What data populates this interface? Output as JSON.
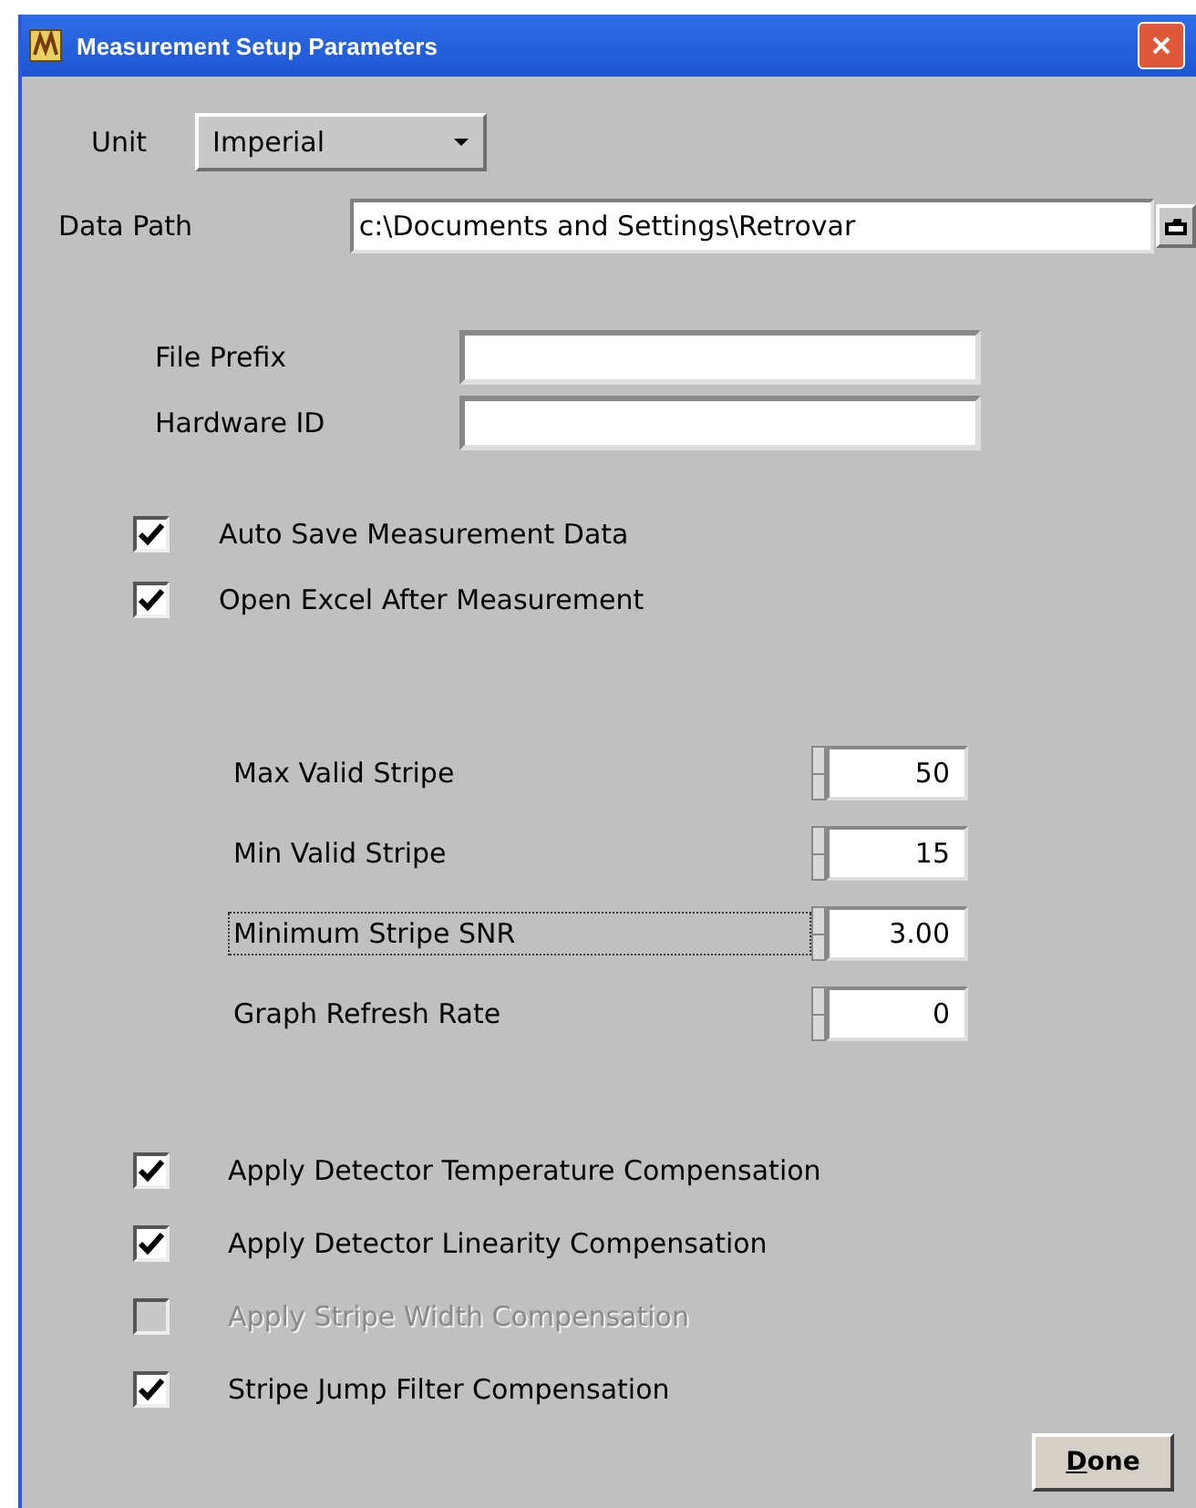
{
  "window": {
    "title": "Measurement Setup Parameters"
  },
  "unit": {
    "label": "Unit",
    "value": "Imperial"
  },
  "data_path": {
    "label": "Data Path",
    "value": "c:\\Documents and Settings\\Retrovar"
  },
  "text_fields": [
    {
      "label": "File Prefix"
    },
    {
      "label": "Hardware ID"
    }
  ],
  "options": [
    {
      "label": "Auto Save Measurement Data",
      "checked": true,
      "disabled": false
    },
    {
      "label": "Open Excel After Measurement",
      "checked": true,
      "disabled": false
    }
  ],
  "numeric_fields": [
    {
      "label": "Max Valid Stripe",
      "value": "50",
      "focused": false
    },
    {
      "label": "Min Valid Stripe",
      "value": "15",
      "focused": false
    },
    {
      "label": "Minimum Stripe SNR",
      "value": "3.00",
      "focused": true
    },
    {
      "label": "Graph Refresh Rate",
      "value": "0",
      "focused": false
    }
  ],
  "compensations": [
    {
      "label": "Apply Detector Temperature Compensation",
      "checked": true,
      "disabled": false
    },
    {
      "label": "Apply Detector Linearity Compensation",
      "checked": true,
      "disabled": false
    },
    {
      "label": "Apply Stripe Width Compensation",
      "checked": false,
      "disabled": true
    },
    {
      "label": "Stripe Jump Filter Compensation",
      "checked": true,
      "disabled": false
    }
  ],
  "buttons": [
    {
      "label": "Done"
    }
  ]
}
